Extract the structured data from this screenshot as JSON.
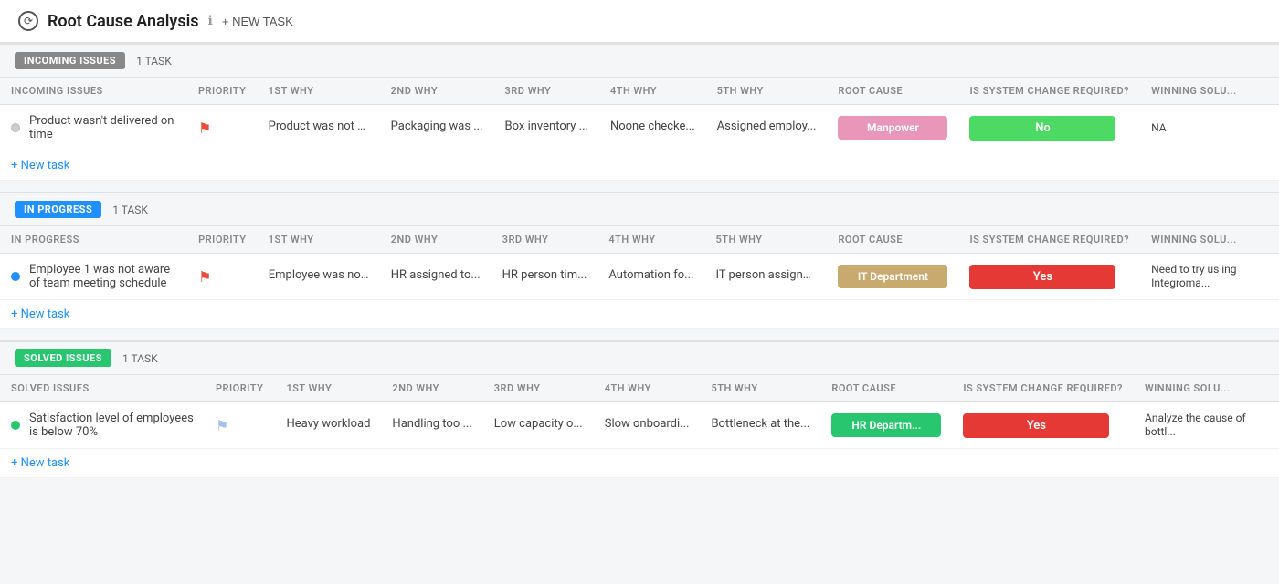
{
  "header": {
    "back_icon": "↺",
    "title": "Root Cause Analysis",
    "info_icon": "ℹ",
    "new_task_label": "+ NEW TASK"
  },
  "columns": {
    "issue": "INCOMING ISSUES",
    "priority": "PRIORITY",
    "why1": "1ST WHY",
    "why2": "2ND WHY",
    "why3": "3RD WHY",
    "why4": "4TH WHY",
    "why5": "5TH WHY",
    "root_cause": "ROOT CAUSE",
    "system_change": "IS SYSTEM CHANGE REQUIRED?",
    "winning_solution": "WINNING SOLU..."
  },
  "sections": [
    {
      "id": "incoming",
      "badge": "INCOMING ISSUES",
      "badge_class": "badge-incoming",
      "task_count": "1 TASK",
      "col_label": "INCOMING ISSUES",
      "tasks": [
        {
          "issue": "Product wasn't delivered on time",
          "dot_class": "dot-gray",
          "flag_class": "flag-icon",
          "why1": "Product was not rea...",
          "why2": "Packaging was ...",
          "why3": "Box inventory ...",
          "why4": "Noone checke...",
          "why5": "Assigned employ...",
          "root_cause": "Manpower",
          "root_class": "root-manpower",
          "system_change": "No",
          "system_class": "system-no",
          "winning": "NA"
        }
      ]
    },
    {
      "id": "inprogress",
      "badge": "IN PROGRESS",
      "badge_class": "badge-inprogress",
      "task_count": "1 TASK",
      "col_label": "IN PROGRESS",
      "tasks": [
        {
          "issue": "Employee 1 was not aware of team meeting schedule",
          "dot_class": "dot-blue",
          "flag_class": "flag-icon",
          "why1": "Employee was not b...",
          "why2": "HR assigned to...",
          "why3": "HR person tim...",
          "why4": "Automation fo...",
          "why5": "IT person assigne...",
          "root_cause": "IT Department",
          "root_class": "root-it",
          "system_change": "Yes",
          "system_class": "system-yes",
          "winning": "Need to try us ing Integroma..."
        }
      ]
    },
    {
      "id": "solved",
      "badge": "SOLVED ISSUES",
      "badge_class": "badge-solved",
      "task_count": "1 TASK",
      "col_label": "SOLVED ISSUES",
      "tasks": [
        {
          "issue": "Satisfaction level of employees is below 70%",
          "dot_class": "dot-green",
          "flag_class": "flag-icon-light",
          "why1": "Heavy workload",
          "why2": "Handling too ...",
          "why3": "Low capacity o...",
          "why4": "Slow onboardi...",
          "why5": "Bottleneck at the...",
          "root_cause": "HR Departm...",
          "root_class": "root-hr",
          "system_change": "Yes",
          "system_class": "system-yes",
          "winning": "Analyze the cause of bottl..."
        }
      ]
    }
  ],
  "new_task_label": "+ New task"
}
